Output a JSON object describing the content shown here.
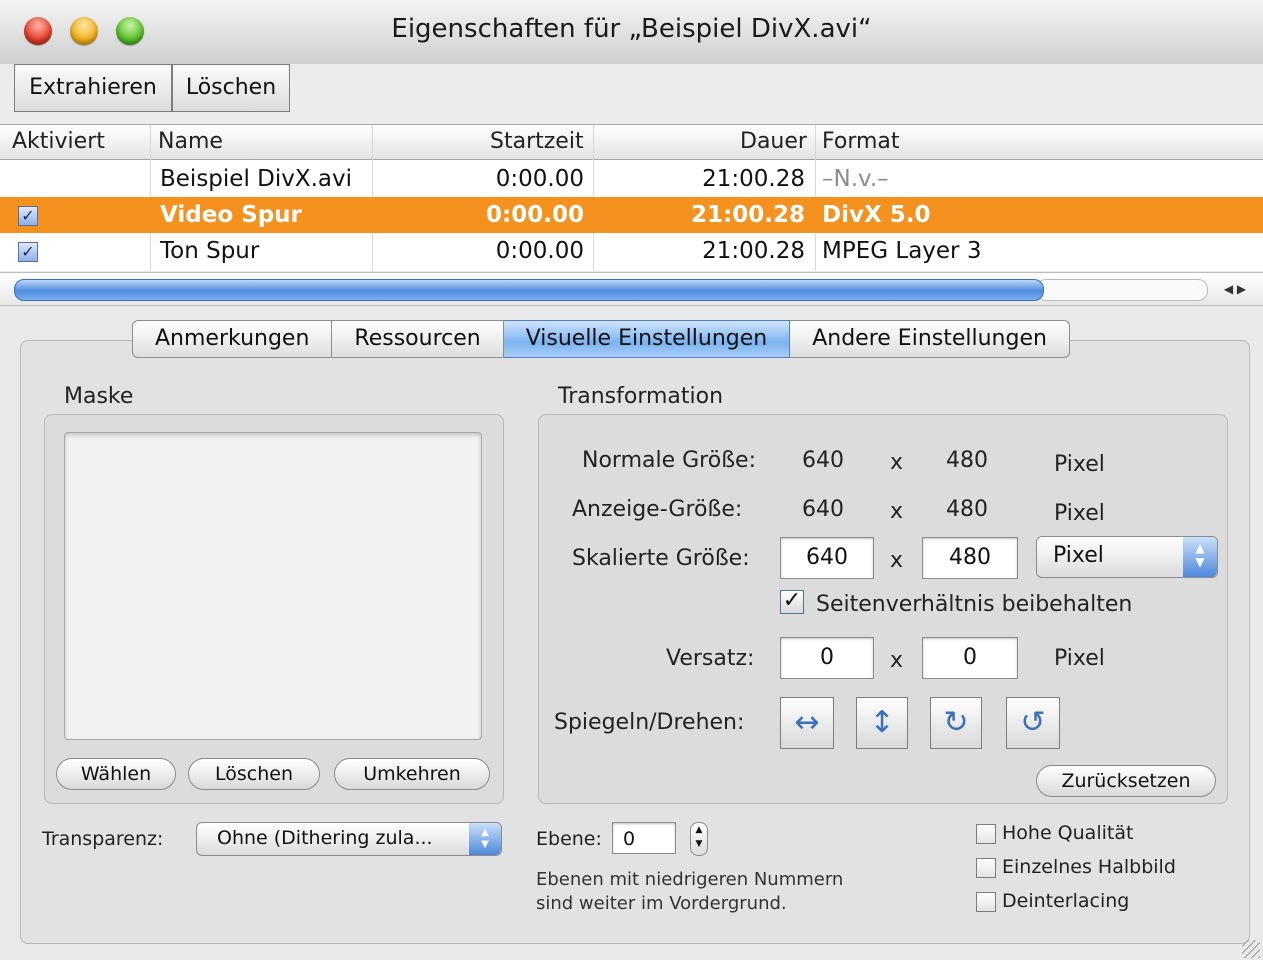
{
  "window": {
    "title": "Eigenschaften für „Beispiel DivX.avi“"
  },
  "toolbar": {
    "extract": "Extrahieren",
    "delete": "Löschen"
  },
  "table": {
    "columns": [
      "Aktiviert",
      "Name",
      "Startzeit",
      "Dauer",
      "Format"
    ],
    "rows": [
      {
        "checked": false,
        "name": "Beispiel DivX.avi",
        "start": "0:00.00",
        "duration": "21:00.28",
        "format": "–N.v.–"
      },
      {
        "checked": true,
        "name": "Video Spur",
        "start": "0:00.00",
        "duration": "21:00.28",
        "format": "DivX 5.0"
      },
      {
        "checked": true,
        "name": "Ton Spur",
        "start": "0:00.00",
        "duration": "21:00.28",
        "format": "MPEG Layer 3"
      }
    ],
    "selected_row_color": "#f5911e"
  },
  "tabs": [
    "Anmerkungen",
    "Ressourcen",
    "Visuelle Einstellungen",
    "Andere Einstellungen"
  ],
  "mask": {
    "title": "Maske",
    "choose": "Wählen",
    "delete": "Löschen",
    "invert": "Umkehren"
  },
  "transformation": {
    "title": "Transformation",
    "normal_label": "Normale Größe:",
    "normal_w": "640",
    "normal_h": "480",
    "display_label": "Anzeige-Größe:",
    "display_w": "640",
    "display_h": "480",
    "scaled_label": "Skalierte Größe:",
    "scaled_w": "640",
    "scaled_h": "480",
    "times": "x",
    "unit": "Pixel",
    "unit_select": "Pixel",
    "keep_aspect": "Seitenverhältnis beibehalten",
    "offset_label": "Versatz:",
    "offset_x": "0",
    "offset_y": "0",
    "flip_label": "Spiegeln/Drehen:",
    "reset": "Zurücksetzen"
  },
  "bottom": {
    "transparency_label": "Transparenz:",
    "transparency_value": "Ohne (Dithering zula...",
    "layer_label": "Ebene:",
    "layer_value": "0",
    "layer_help_1": "Ebenen mit niedrigeren Nummern",
    "layer_help_2": "sind weiter im Vordergrund.",
    "high_quality": "Hohe Qualität",
    "single_field": "Einzelnes Halbbild",
    "deinterlacing": "Deinterlacing"
  },
  "icons": [
    "flip-horizontal-icon",
    "flip-vertical-icon",
    "rotate-right-icon",
    "rotate-left-icon"
  ]
}
